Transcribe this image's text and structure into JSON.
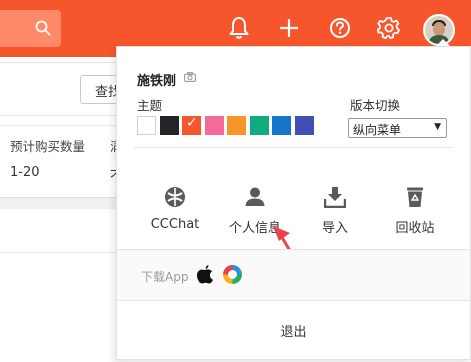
{
  "colors": {
    "brand": "#f7552b",
    "arrow": "#e8434b"
  },
  "header": {
    "icons": [
      "search-icon",
      "bell-icon",
      "plus-icon",
      "help-icon",
      "gear-icon",
      "avatar"
    ]
  },
  "background": {
    "find_button_label": "查找",
    "columns": [
      "预计购买数量",
      "满"
    ],
    "row": [
      "1-20",
      "不"
    ]
  },
  "menu": {
    "user_name": "施铁刚",
    "theme_label": "主题",
    "version_label": "版本切换",
    "themes": [
      {
        "color": "#ffffff",
        "selected": false
      },
      {
        "color": "#222427",
        "selected": false
      },
      {
        "color": "#f7552b",
        "selected": true
      },
      {
        "color": "#f46a9b",
        "selected": false
      },
      {
        "color": "#f7952a",
        "selected": false
      },
      {
        "color": "#10ab7e",
        "selected": false
      },
      {
        "color": "#1475c9",
        "selected": false
      },
      {
        "color": "#3f4fb3",
        "selected": false
      }
    ],
    "version_selected": "纵向菜单",
    "actions": [
      {
        "label": "CCChat",
        "icon": "ccchat-icon"
      },
      {
        "label": "个人信息",
        "icon": "person-icon"
      },
      {
        "label": "导入",
        "icon": "import-icon"
      },
      {
        "label": "回收站",
        "icon": "recycle-bin-icon"
      }
    ],
    "download_label": "下载App",
    "download_icons": [
      "apple-icon",
      "android-app-icon"
    ],
    "logout_label": "退出"
  }
}
